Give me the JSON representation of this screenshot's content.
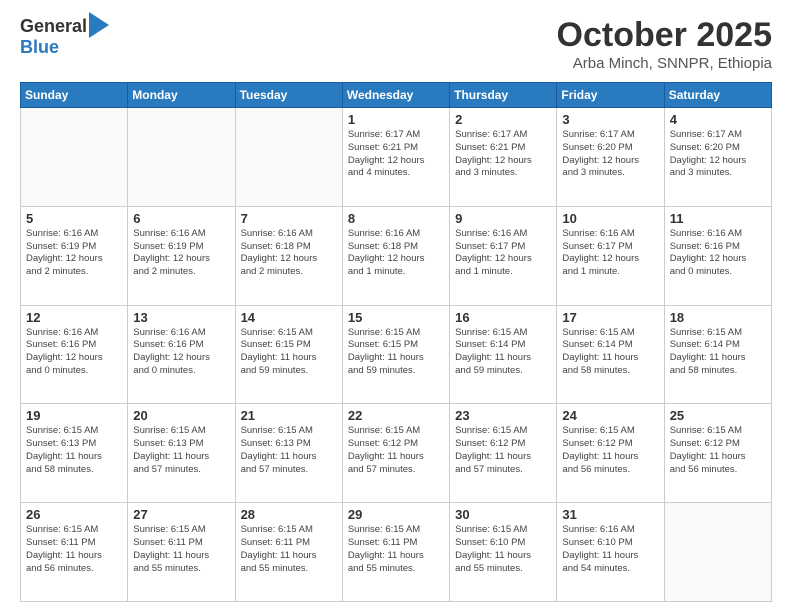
{
  "logo": {
    "general": "General",
    "blue": "Blue"
  },
  "header": {
    "month": "October 2025",
    "location": "Arba Minch, SNNPR, Ethiopia"
  },
  "weekdays": [
    "Sunday",
    "Monday",
    "Tuesday",
    "Wednesday",
    "Thursday",
    "Friday",
    "Saturday"
  ],
  "weeks": [
    [
      {
        "day": "",
        "info": ""
      },
      {
        "day": "",
        "info": ""
      },
      {
        "day": "",
        "info": ""
      },
      {
        "day": "1",
        "info": "Sunrise: 6:17 AM\nSunset: 6:21 PM\nDaylight: 12 hours\nand 4 minutes."
      },
      {
        "day": "2",
        "info": "Sunrise: 6:17 AM\nSunset: 6:21 PM\nDaylight: 12 hours\nand 3 minutes."
      },
      {
        "day": "3",
        "info": "Sunrise: 6:17 AM\nSunset: 6:20 PM\nDaylight: 12 hours\nand 3 minutes."
      },
      {
        "day": "4",
        "info": "Sunrise: 6:17 AM\nSunset: 6:20 PM\nDaylight: 12 hours\nand 3 minutes."
      }
    ],
    [
      {
        "day": "5",
        "info": "Sunrise: 6:16 AM\nSunset: 6:19 PM\nDaylight: 12 hours\nand 2 minutes."
      },
      {
        "day": "6",
        "info": "Sunrise: 6:16 AM\nSunset: 6:19 PM\nDaylight: 12 hours\nand 2 minutes."
      },
      {
        "day": "7",
        "info": "Sunrise: 6:16 AM\nSunset: 6:18 PM\nDaylight: 12 hours\nand 2 minutes."
      },
      {
        "day": "8",
        "info": "Sunrise: 6:16 AM\nSunset: 6:18 PM\nDaylight: 12 hours\nand 1 minute."
      },
      {
        "day": "9",
        "info": "Sunrise: 6:16 AM\nSunset: 6:17 PM\nDaylight: 12 hours\nand 1 minute."
      },
      {
        "day": "10",
        "info": "Sunrise: 6:16 AM\nSunset: 6:17 PM\nDaylight: 12 hours\nand 1 minute."
      },
      {
        "day": "11",
        "info": "Sunrise: 6:16 AM\nSunset: 6:16 PM\nDaylight: 12 hours\nand 0 minutes."
      }
    ],
    [
      {
        "day": "12",
        "info": "Sunrise: 6:16 AM\nSunset: 6:16 PM\nDaylight: 12 hours\nand 0 minutes."
      },
      {
        "day": "13",
        "info": "Sunrise: 6:16 AM\nSunset: 6:16 PM\nDaylight: 12 hours\nand 0 minutes."
      },
      {
        "day": "14",
        "info": "Sunrise: 6:15 AM\nSunset: 6:15 PM\nDaylight: 11 hours\nand 59 minutes."
      },
      {
        "day": "15",
        "info": "Sunrise: 6:15 AM\nSunset: 6:15 PM\nDaylight: 11 hours\nand 59 minutes."
      },
      {
        "day": "16",
        "info": "Sunrise: 6:15 AM\nSunset: 6:14 PM\nDaylight: 11 hours\nand 59 minutes."
      },
      {
        "day": "17",
        "info": "Sunrise: 6:15 AM\nSunset: 6:14 PM\nDaylight: 11 hours\nand 58 minutes."
      },
      {
        "day": "18",
        "info": "Sunrise: 6:15 AM\nSunset: 6:14 PM\nDaylight: 11 hours\nand 58 minutes."
      }
    ],
    [
      {
        "day": "19",
        "info": "Sunrise: 6:15 AM\nSunset: 6:13 PM\nDaylight: 11 hours\nand 58 minutes."
      },
      {
        "day": "20",
        "info": "Sunrise: 6:15 AM\nSunset: 6:13 PM\nDaylight: 11 hours\nand 57 minutes."
      },
      {
        "day": "21",
        "info": "Sunrise: 6:15 AM\nSunset: 6:13 PM\nDaylight: 11 hours\nand 57 minutes."
      },
      {
        "day": "22",
        "info": "Sunrise: 6:15 AM\nSunset: 6:12 PM\nDaylight: 11 hours\nand 57 minutes."
      },
      {
        "day": "23",
        "info": "Sunrise: 6:15 AM\nSunset: 6:12 PM\nDaylight: 11 hours\nand 57 minutes."
      },
      {
        "day": "24",
        "info": "Sunrise: 6:15 AM\nSunset: 6:12 PM\nDaylight: 11 hours\nand 56 minutes."
      },
      {
        "day": "25",
        "info": "Sunrise: 6:15 AM\nSunset: 6:12 PM\nDaylight: 11 hours\nand 56 minutes."
      }
    ],
    [
      {
        "day": "26",
        "info": "Sunrise: 6:15 AM\nSunset: 6:11 PM\nDaylight: 11 hours\nand 56 minutes."
      },
      {
        "day": "27",
        "info": "Sunrise: 6:15 AM\nSunset: 6:11 PM\nDaylight: 11 hours\nand 55 minutes."
      },
      {
        "day": "28",
        "info": "Sunrise: 6:15 AM\nSunset: 6:11 PM\nDaylight: 11 hours\nand 55 minutes."
      },
      {
        "day": "29",
        "info": "Sunrise: 6:15 AM\nSunset: 6:11 PM\nDaylight: 11 hours\nand 55 minutes."
      },
      {
        "day": "30",
        "info": "Sunrise: 6:15 AM\nSunset: 6:10 PM\nDaylight: 11 hours\nand 55 minutes."
      },
      {
        "day": "31",
        "info": "Sunrise: 6:16 AM\nSunset: 6:10 PM\nDaylight: 11 hours\nand 54 minutes."
      },
      {
        "day": "",
        "info": ""
      }
    ]
  ]
}
